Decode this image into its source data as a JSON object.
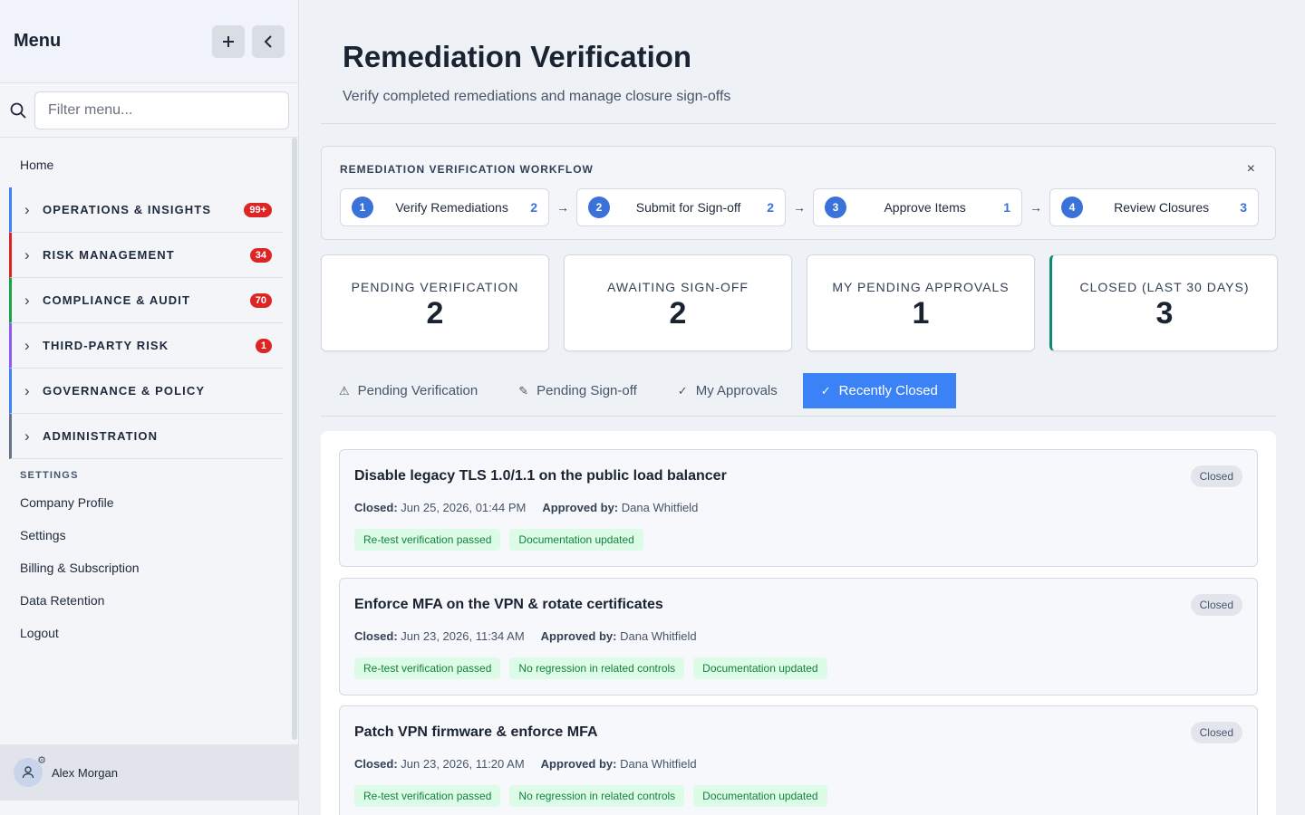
{
  "sidebar": {
    "title": "Menu",
    "filter_placeholder": "Filter menu...",
    "home": "Home",
    "groups": [
      {
        "label": "OPERATIONS & INSIGHTS",
        "badge": "99+",
        "color": "#3b82f6"
      },
      {
        "label": "RISK MANAGEMENT",
        "badge": "34",
        "color": "#dc2626"
      },
      {
        "label": "COMPLIANCE & AUDIT",
        "badge": "70",
        "color": "#16a34a"
      },
      {
        "label": "THIRD-PARTY RISK",
        "badge": "1",
        "color": "#8b5cf6"
      },
      {
        "label": "GOVERNANCE & POLICY",
        "badge": "",
        "color": "#3b82f6"
      },
      {
        "label": "ADMINISTRATION",
        "badge": "",
        "color": "#64748b"
      }
    ],
    "settings_header": "SETTINGS",
    "settings_links": [
      "Company Profile",
      "Settings",
      "Billing & Subscription",
      "Data Retention",
      "Logout"
    ],
    "user": "Alex Morgan"
  },
  "page": {
    "title": "Remediation Verification",
    "subtitle": "Verify completed remediations and manage closure sign-offs"
  },
  "workflow": {
    "title": "REMEDIATION VERIFICATION WORKFLOW",
    "close": "×",
    "steps": [
      {
        "num": "1",
        "label": "Verify Remediations",
        "count": "2"
      },
      {
        "num": "2",
        "label": "Submit for Sign-off",
        "count": "2"
      },
      {
        "num": "3",
        "label": "Approve Items",
        "count": "1"
      },
      {
        "num": "4",
        "label": "Review Closures",
        "count": "3"
      }
    ],
    "arrow": "→"
  },
  "stats": [
    {
      "label": "PENDING VERIFICATION",
      "value": "2"
    },
    {
      "label": "AWAITING SIGN-OFF",
      "value": "2"
    },
    {
      "label": "MY PENDING APPROVALS",
      "value": "1"
    },
    {
      "label": "CLOSED (LAST 30 DAYS)",
      "value": "3"
    }
  ],
  "tabs": [
    {
      "icon": "⚠",
      "label": "Pending Verification"
    },
    {
      "icon": "✎",
      "label": "Pending Sign-off"
    },
    {
      "icon": "✓",
      "label": "My Approvals"
    },
    {
      "icon": "✓",
      "label": "Recently Closed"
    }
  ],
  "closed_items": [
    {
      "title": "Disable legacy TLS 1.0/1.1 on the public load balancer",
      "status": "Closed",
      "closed_label": "Closed:",
      "closed": "Jun 25, 2026, 01:44 PM",
      "approved_label": "Approved by:",
      "approved_by": "Dana Whitfield",
      "tags": [
        "Re-test verification passed",
        "Documentation updated"
      ]
    },
    {
      "title": "Enforce MFA on the VPN & rotate certificates",
      "status": "Closed",
      "closed_label": "Closed:",
      "closed": "Jun 23, 2026, 11:34 AM",
      "approved_label": "Approved by:",
      "approved_by": "Dana Whitfield",
      "tags": [
        "Re-test verification passed",
        "No regression in related controls",
        "Documentation updated"
      ]
    },
    {
      "title": "Patch VPN firmware & enforce MFA",
      "status": "Closed",
      "closed_label": "Closed:",
      "closed": "Jun 23, 2026, 11:20 AM",
      "approved_label": "Approved by:",
      "approved_by": "Dana Whitfield",
      "tags": [
        "Re-test verification passed",
        "No regression in related controls",
        "Documentation updated"
      ]
    }
  ]
}
